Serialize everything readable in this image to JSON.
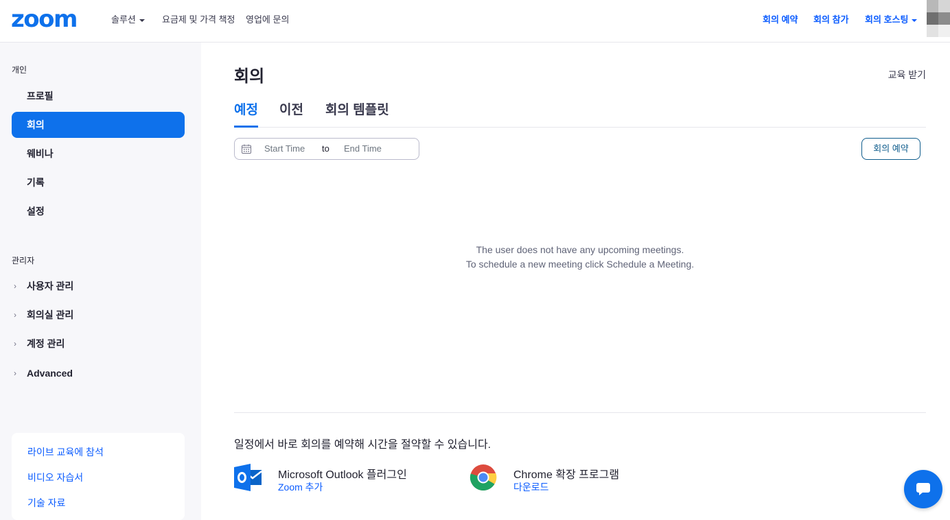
{
  "header": {
    "logo": "zoom",
    "nav": [
      {
        "label": "솔루션",
        "dropdown": true
      },
      {
        "label": "요금제 및 가격 책정",
        "dropdown": false
      },
      {
        "label": "영업에 문의",
        "dropdown": false
      }
    ],
    "actions": [
      {
        "label": "회의 예약"
      },
      {
        "label": "회의 참가"
      },
      {
        "label": "회의 호스팅",
        "dropdown": true
      }
    ]
  },
  "sidebar": {
    "personal_label": "개인",
    "personal_items": [
      {
        "label": "프로필",
        "active": false
      },
      {
        "label": "회의",
        "active": true
      },
      {
        "label": "웨비나",
        "active": false
      },
      {
        "label": "기록",
        "active": false
      },
      {
        "label": "설정",
        "active": false
      }
    ],
    "admin_label": "관리자",
    "admin_items": [
      {
        "label": "사용자 관리"
      },
      {
        "label": "회의실 관리"
      },
      {
        "label": "계정 관리"
      },
      {
        "label": "Advanced"
      }
    ],
    "help_links": [
      {
        "label": "라이브 교육에 참석"
      },
      {
        "label": "비디오 자습서"
      },
      {
        "label": "기술 자료"
      }
    ]
  },
  "main": {
    "title": "회의",
    "training_link": "교육 받기",
    "tabs": [
      {
        "label": "예정",
        "active": true
      },
      {
        "label": "이전",
        "active": false
      },
      {
        "label": "회의 템플릿",
        "active": false
      }
    ],
    "date_range": {
      "start_placeholder": "Start Time",
      "separator": "to",
      "end_placeholder": "End Time"
    },
    "schedule_button": "회의 예약",
    "empty_line1": "The user does not have any upcoming meetings.",
    "empty_line2": "To schedule a new meeting click Schedule a Meeting.",
    "promo_text": "일정에서 바로 회의를 예약해 시간을 절약할 수 있습니다.",
    "plugins": [
      {
        "title": "Microsoft Outlook 플러그인",
        "link": "Zoom 추가",
        "icon": "outlook-icon"
      },
      {
        "title": "Chrome 확장 프로그램",
        "link": "다운로드",
        "icon": "chrome-icon"
      }
    ]
  },
  "colors": {
    "brand": "#0e71eb",
    "link": "#0b5cff",
    "sidebar_bg": "#f7f7fa"
  }
}
